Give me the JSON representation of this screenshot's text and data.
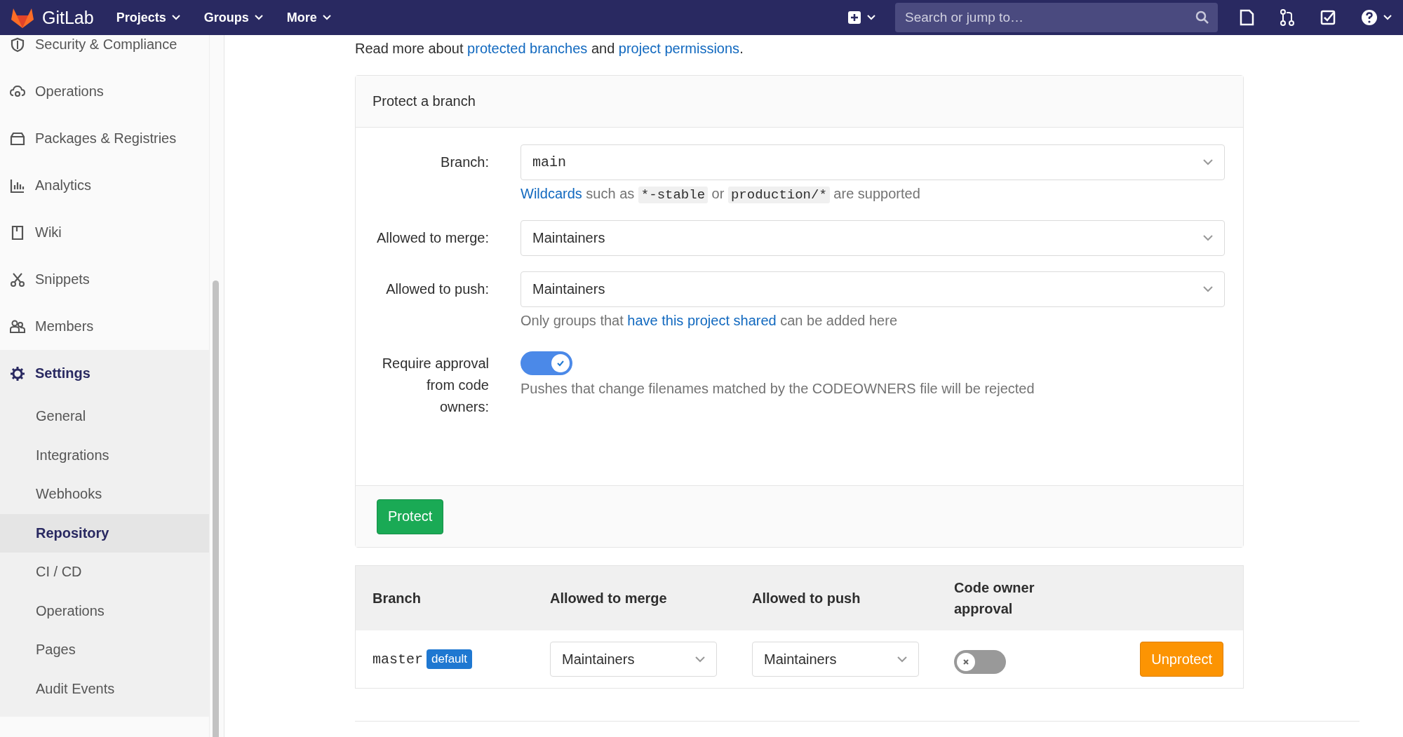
{
  "navbar": {
    "brand": "GitLab",
    "menus": [
      {
        "label": "Projects"
      },
      {
        "label": "Groups"
      },
      {
        "label": "More"
      }
    ],
    "search": {
      "placeholder": "Search or jump to…"
    }
  },
  "sidebar": {
    "items": [
      {
        "label": "Security & Compliance",
        "selected": false
      },
      {
        "label": "Operations",
        "selected": false
      },
      {
        "label": "Packages & Registries",
        "selected": false
      },
      {
        "label": "Analytics",
        "selected": false
      },
      {
        "label": "Wiki",
        "selected": false
      },
      {
        "label": "Snippets",
        "selected": false
      },
      {
        "label": "Members",
        "selected": false
      },
      {
        "label": "Settings",
        "selected": true,
        "expanded": true,
        "children": [
          {
            "label": "General",
            "selected": false
          },
          {
            "label": "Integrations",
            "selected": false
          },
          {
            "label": "Webhooks",
            "selected": false
          },
          {
            "label": "Repository",
            "selected": true
          },
          {
            "label": "CI / CD",
            "selected": false
          },
          {
            "label": "Operations",
            "selected": false
          },
          {
            "label": "Pages",
            "selected": false
          },
          {
            "label": "Audit Events",
            "selected": false
          }
        ]
      }
    ]
  },
  "intro": [
    {
      "kind": "text",
      "text": "Read more about "
    },
    {
      "kind": "link",
      "text": "protected branches"
    },
    {
      "kind": "text",
      "text": " and "
    },
    {
      "kind": "link",
      "text": "project permissions"
    },
    {
      "kind": "text",
      "text": "."
    }
  ],
  "protect_card": {
    "title": "Protect a branch",
    "fields": [
      {
        "kind": "select",
        "label": "Branch:",
        "value": "main",
        "monospace": true,
        "hint": [
          {
            "kind": "link",
            "text": "Wildcards"
          },
          {
            "kind": "text",
            "text": " such as "
          },
          {
            "kind": "code",
            "text": "*-stable"
          },
          {
            "kind": "text",
            "text": " or "
          },
          {
            "kind": "code",
            "text": "production/*"
          },
          {
            "kind": "text",
            "text": " are supported"
          }
        ]
      },
      {
        "kind": "select",
        "label": "Allowed to merge:",
        "value": "Maintainers"
      },
      {
        "kind": "select",
        "label": "Allowed to push:",
        "value": "Maintainers",
        "hint": [
          {
            "kind": "text",
            "text": "Only groups that "
          },
          {
            "kind": "link",
            "text": "have this project shared"
          },
          {
            "kind": "text",
            "text": " can be added here"
          }
        ]
      },
      {
        "kind": "toggle",
        "label": "Require approval from code owners:",
        "on": true,
        "hint": [
          {
            "kind": "text",
            "text": "Pushes that change filenames matched by the CODEOWNERS file will be rejected"
          }
        ]
      }
    ],
    "button": "Protect"
  },
  "table": {
    "columns": [
      "Branch",
      "Allowed to merge",
      "Allowed to push",
      "Code owner approval"
    ],
    "rows": [
      {
        "branch": "master",
        "badge": "default",
        "merge": "Maintainers",
        "push": "Maintainers",
        "code_owner_approval": false,
        "action": "Unprotect"
      }
    ]
  }
}
